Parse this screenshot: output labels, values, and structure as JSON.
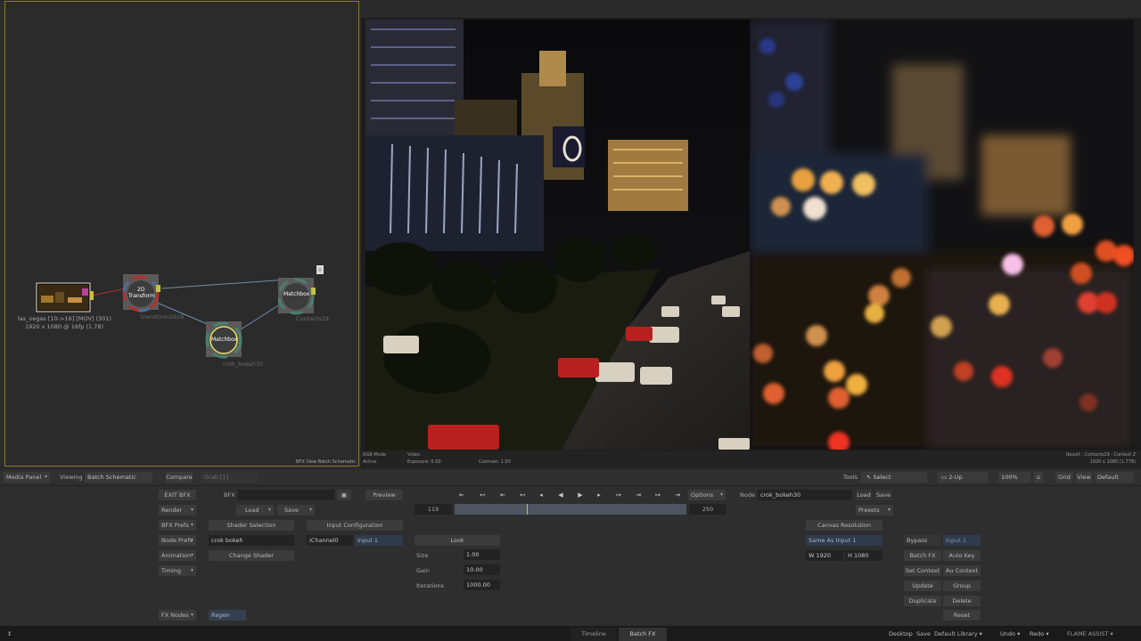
{
  "schematic": {
    "nodes": {
      "clip_name": "las_vegas [10->16] [MOV] (301)",
      "clip_info": "1920 x 1080 @ 16fp (1.78)",
      "transform_title_1": "2D",
      "transform_title_2": "Transform",
      "transform_name": "transform2929",
      "bokeh_title": "Matchbox",
      "bokeh_name": "crok_bokeh30",
      "contacts_title": "Matchbox",
      "contacts_name": "Contacts29"
    },
    "footer_label": "BFX View",
    "footer_value": "Batch Schematic"
  },
  "viewer": {
    "rgb_mode_label": "RGB Mode",
    "rgb_mode_value": "Active",
    "video_label": "Video",
    "exposure": "Exposure: 0.00",
    "contrast": "Contrast: 1.00",
    "result": "Result : Contacts29 : Context 2",
    "resolution": "1920 x 1080 (1.778)"
  },
  "toolbar": {
    "media_panel": "Media Panel",
    "viewing_label": "Viewing",
    "viewing_value": "Batch Schematic",
    "compare": "Compare",
    "grab": "Grab [1]",
    "tools_label": "Tools",
    "select": "Select",
    "twoup": "2-Up",
    "zoom": "100%",
    "grid": "Grid",
    "view": "View",
    "default": "Default"
  },
  "panel": {
    "exit_bfx": "EXIT BFX",
    "bfx_label": "BFX",
    "preview": "Preview",
    "render": "Render",
    "load": "Load",
    "save": "Save",
    "bfx_prefs": "BFX Prefs",
    "node_prefs": "Node Prefs",
    "animation": "Animation",
    "timing": "Timing",
    "fx_nodes": "FX Nodes",
    "regen": "Regen",
    "shader_selection": "Shader Selection",
    "shader_name": "crok bokeh",
    "change_shader": "Change Shader",
    "input_configuration": "Input Configuration",
    "ichannel": "iChannel0",
    "input1": "Input 1",
    "frame_start": "119",
    "frame_end": "250",
    "timeline_progress": 0.31,
    "options": "Options",
    "look": "Look",
    "size_label": "Size",
    "size_value": "1.00",
    "gain_label": "Gain",
    "gain_value": "10.00",
    "iterations_label": "Iterations",
    "iterations_value": "1000.00",
    "node_label": "Node",
    "node_name": "crok_bokeh30",
    "node_load": "Load",
    "node_save": "Save",
    "presets": "Presets",
    "canvas_resolution": "Canvas Resolution",
    "same_as_input": "Same As Input 1",
    "width": "W 1920",
    "height": "H 1080",
    "bypass": "Bypass",
    "bypass_input": "Input 1",
    "batch_fx": "Batch FX",
    "auto_key": "Auto Key",
    "set_context": "Set Context",
    "au_context": "Au Context",
    "update": "Update",
    "group": "Group",
    "duplicate": "Duplicate",
    "delete": "Delete",
    "reset": "Reset"
  },
  "statusbar": {
    "tab_timeline": "Timeline",
    "tab_batchfx": "Batch FX",
    "desktop": "Desktop",
    "save": "Save",
    "library": "Default Library",
    "undo": "Undo",
    "redo": "Redo",
    "app": "FLAME ASSIST"
  },
  "colors": {
    "accent_yellow": "#c8c040",
    "selection_border": "#8c7a2a",
    "link_blue": "#6f8fb0"
  }
}
